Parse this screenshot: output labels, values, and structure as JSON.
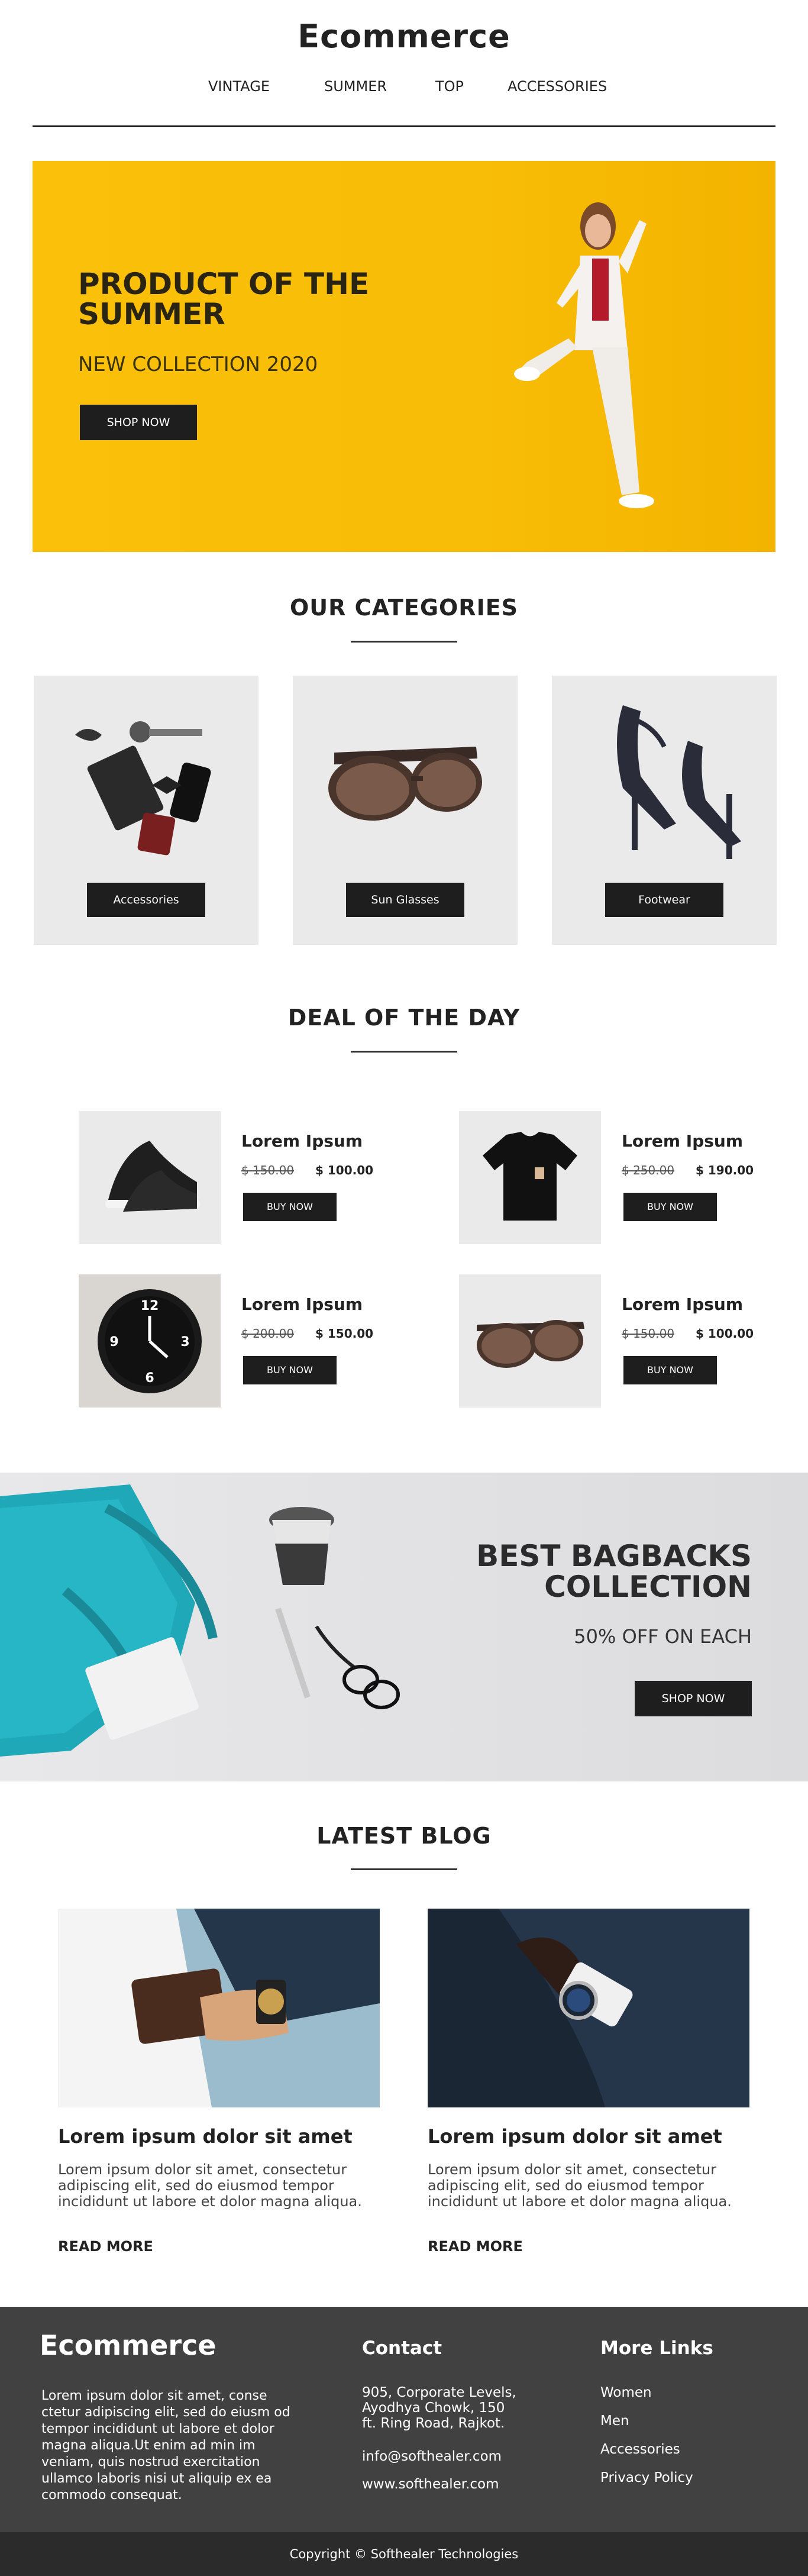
{
  "brand": "Ecommerce",
  "nav": [
    "VINTAGE",
    "SUMMER",
    "TOP",
    "ACCESSORIES"
  ],
  "hero": {
    "title": "PRODUCT OF THE SUMMER",
    "subtitle": "NEW COLLECTION 2020",
    "button": "SHOP NOW"
  },
  "categories": {
    "title": "OUR CATEGORIES",
    "items": [
      "Accessories",
      "Sun Glasses",
      "Footwear"
    ]
  },
  "deals": {
    "title": "DEAL OF THE DAY",
    "items": [
      {
        "name": "Lorem Ipsum",
        "old_price": "$ 150.00",
        "new_price": "$ 100.00",
        "button": "BUY NOW",
        "icon": "sneaker-icon"
      },
      {
        "name": "Lorem Ipsum",
        "old_price": "$ 250.00",
        "new_price": "$ 190.00",
        "button": "BUY NOW",
        "icon": "tshirt-icon"
      },
      {
        "name": "Lorem Ipsum",
        "old_price": "$ 200.00",
        "new_price": "$ 150.00",
        "button": "BUY NOW",
        "icon": "clock-icon"
      },
      {
        "name": "Lorem Ipsum",
        "old_price": "$ 150.00",
        "new_price": "$ 100.00",
        "button": "BUY NOW",
        "icon": "sunglasses-icon"
      }
    ]
  },
  "bags": {
    "title_line1": "BEST BAGBACKS",
    "title_line2": "COLLECTION",
    "subtitle": "50% OFF ON EACH",
    "button": "SHOP NOW"
  },
  "blog": {
    "title": "LATEST BLOG",
    "posts": [
      {
        "title": "Lorem ipsum dolor sit amet",
        "text": "Lorem ipsum dolor sit amet, consectetur adipiscing elit, sed do eiusmod tempor incididunt ut labore et dolor magna aliqua.",
        "more": "READ MORE"
      },
      {
        "title": "Lorem ipsum dolor sit amet",
        "text": "Lorem ipsum dolor sit amet, consectetur adipiscing elit, sed do eiusmod tempor incididunt ut labore et dolor magna aliqua.",
        "more": "READ MORE"
      }
    ]
  },
  "footer": {
    "brand": "Ecommerce",
    "about": "Lorem ipsum dolor sit amet, conse ctetur adipiscing elit, sed do eiusm od tempor incididunt ut labore et dolor magna aliqua.Ut enim ad min im veniam, quis nostrud exercitation ullamco laboris nisi ut aliquip ex ea commodo consequat.",
    "contact_title": "Contact",
    "address_line1": "905, Corporate Levels,",
    "address_line2": "Ayodhya Chowk, 150",
    "address_line3": "ft. Ring Road, Rajkot.",
    "email": "info@softhealer.com",
    "website": "www.softhealer.com",
    "links_title": "More Links",
    "links": [
      "Women",
      "Men",
      "Accessories",
      "Privacy Policy"
    ],
    "copyright": "Copyright © Softhealer Technologies"
  },
  "colors": {
    "hero_bg": "#f8bd06",
    "button_bg": "#1e1e1e",
    "footer_bg": "#414141",
    "footer_bottom_bg": "#2b2b2b",
    "category_bg": "#eaeaea"
  }
}
